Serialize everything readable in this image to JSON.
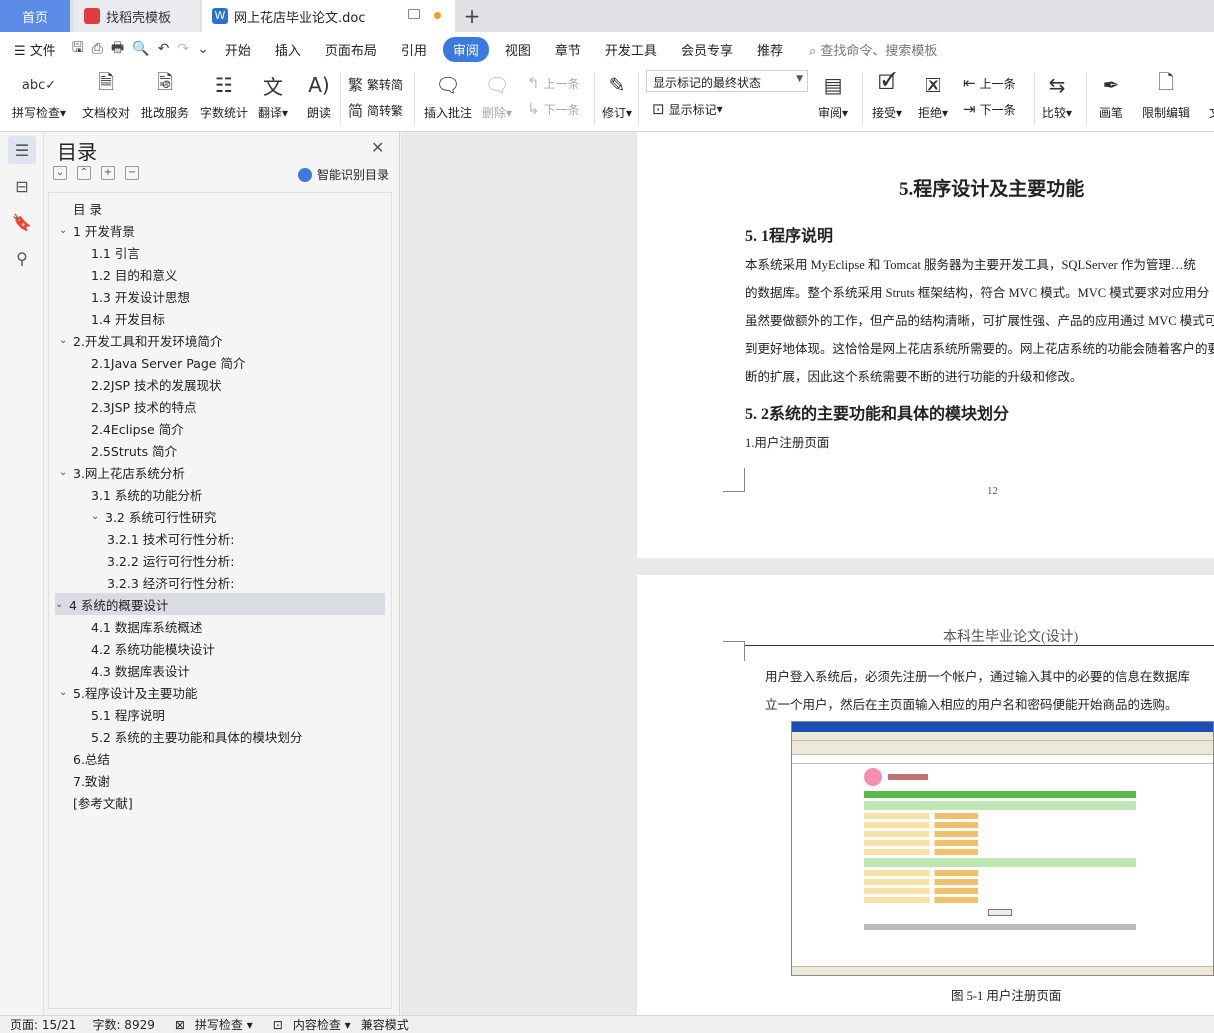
{
  "tabs": {
    "home": "首页",
    "template": "找稻壳模板",
    "doc": "网上花店毕业论文.doc"
  },
  "menu": {
    "file": "文件",
    "items": [
      "开始",
      "插入",
      "页面布局",
      "引用",
      "审阅",
      "视图",
      "章节",
      "开发工具",
      "会员专享",
      "推荐"
    ],
    "active": "审阅",
    "search": "查找命令、搜索模板"
  },
  "ribbon": {
    "spell": "拼写检查",
    "doccheck": "文档校对",
    "correction": "批改服务",
    "wordcount": "字数统计",
    "translate": "翻译",
    "read": "朗读",
    "trad": "繁转简",
    "simp": "简转繁",
    "insert_comment": "插入批注",
    "delete": "删除",
    "prev": "上一条",
    "next": "下一条",
    "revise": "修订",
    "markup_state": "显示标记的最终状态",
    "show_markup": "显示标记",
    "review": "审阅",
    "accept": "接受",
    "reject": "拒绝",
    "prev2": "上一条",
    "next2": "下一条",
    "compare": "比较",
    "pen": "画笔",
    "restrict": "限制编辑",
    "doc_cut": "文"
  },
  "nav": {
    "title": "目录",
    "ai": "智能识别目录",
    "items": [
      {
        "text": "目  录",
        "level": 0,
        "chev": ""
      },
      {
        "text": "1  开发背景",
        "level": 0,
        "chev": "v"
      },
      {
        "text": "1.1 引言",
        "level": 1,
        "chev": ""
      },
      {
        "text": "1.2 目的和意义",
        "level": 1,
        "chev": ""
      },
      {
        "text": "1.3 开发设计思想",
        "level": 1,
        "chev": ""
      },
      {
        "text": "1.4 开发目标",
        "level": 1,
        "chev": ""
      },
      {
        "text": "2.开发工具和开发环境简介",
        "level": 0,
        "chev": "v"
      },
      {
        "text": "2.1Java Server Page  简介",
        "level": 1,
        "chev": ""
      },
      {
        "text": "2.2JSP 技术的发展现状",
        "level": 1,
        "chev": ""
      },
      {
        "text": "2.3JSP 技术的特点",
        "level": 1,
        "chev": ""
      },
      {
        "text": "2.4Eclipse 简介",
        "level": 1,
        "chev": ""
      },
      {
        "text": "2.5Struts 简介",
        "level": 1,
        "chev": ""
      },
      {
        "text": "3.网上花店系统分析",
        "level": 0,
        "chev": "v"
      },
      {
        "text": "3.1 系统的功能分析",
        "level": 1,
        "chev": ""
      },
      {
        "text": "3.2 系统可行性研究",
        "level": 1,
        "chev": "v"
      },
      {
        "text": "3.2.1 技术可行性分析:",
        "level": 2,
        "chev": ""
      },
      {
        "text": "3.2.2 运行可行性分析:",
        "level": 2,
        "chev": ""
      },
      {
        "text": "3.2.3 经济可行性分析:",
        "level": 2,
        "chev": ""
      },
      {
        "text": "4 系统的概要设计",
        "level": 0,
        "chev": "v"
      },
      {
        "text": "4.1 数据库系统概述",
        "level": 1,
        "chev": ""
      },
      {
        "text": "4.2 系统功能模块设计",
        "level": 1,
        "chev": ""
      },
      {
        "text": "4.3 数据库表设计",
        "level": 1,
        "chev": ""
      },
      {
        "text": "5.程序设计及主要功能",
        "level": 0,
        "chev": "v"
      },
      {
        "text": "5.1 程序说明",
        "level": 1,
        "chev": ""
      },
      {
        "text": "5.2 系统的主要功能和具体的模块划分",
        "level": 1,
        "chev": ""
      },
      {
        "text": "6.总结",
        "level": 0,
        "chev": ""
      },
      {
        "text": "7.致谢",
        "level": 0,
        "chev": ""
      },
      {
        "text": " [参考文献]",
        "level": 0,
        "chev": ""
      }
    ],
    "selected": 18
  },
  "doc": {
    "page1": {
      "heading": "5.程序设计及主要功能",
      "sub1": "5. 1程序说明",
      "lines": [
        "        本系统采用 MyEclipse 和 Tomcat 服务器为主要开发工具，SQLServer 作为管理…统",
        "的数据库。整个系统采用 Struts 框架结构，符合 MVC 模式。MVC 模式要求对应用分",
        "虽然要做额外的工作，但产品的结构清晰，可扩展性强、产品的应用通过 MVC 模式可",
        "到更好地体现。这恰恰是网上花店系统所需要的。网上花店系统的功能会随着客户的要",
        "断的扩展，因此这个系统需要不断的进行功能的升级和修改。"
      ],
      "sub2": "5. 2系统的主要功能和具体的模块划分",
      "item1": "1.用户注册页面",
      "page_number": "12"
    },
    "page2": {
      "header": "本科生毕业论文(设计)",
      "lines": [
        "        用户登入系统后，必须先注册一个帐户，通过输入其中的必要的信息在数据库",
        "立一个用户，然后在主页面输入相应的用户名和密码便能开始商品的选购。"
      ],
      "caption": "图 5-1 用户注册页面"
    }
  },
  "status": {
    "page": "页面: 15/21",
    "words": "字数: 8929",
    "spell": "拼写检查",
    "content": "内容检查",
    "compat": "兼容模式"
  },
  "colors": {
    "accent": "#3d7ae0",
    "home_tab": "#5a8ce8"
  }
}
